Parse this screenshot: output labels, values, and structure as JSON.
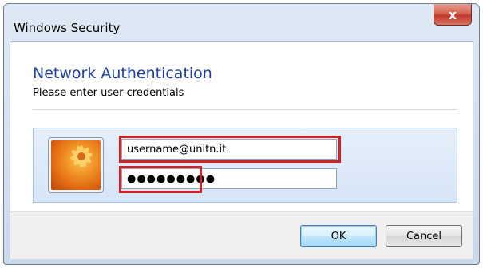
{
  "window": {
    "title": "Windows Security",
    "close_glyph": "x"
  },
  "header": {
    "title": "Network Authentication",
    "subtitle": "Please enter user credentials"
  },
  "credentials": {
    "username_value": "username@unitn.it",
    "password_value": "●●●●●●●●●",
    "avatar_icon": "user-avatar-flower-icon"
  },
  "buttons": {
    "ok_label": "OK",
    "cancel_label": "Cancel"
  },
  "colors": {
    "highlight": "#d22027",
    "header_title": "#1e3f9b",
    "close_button": "#c0392b"
  }
}
